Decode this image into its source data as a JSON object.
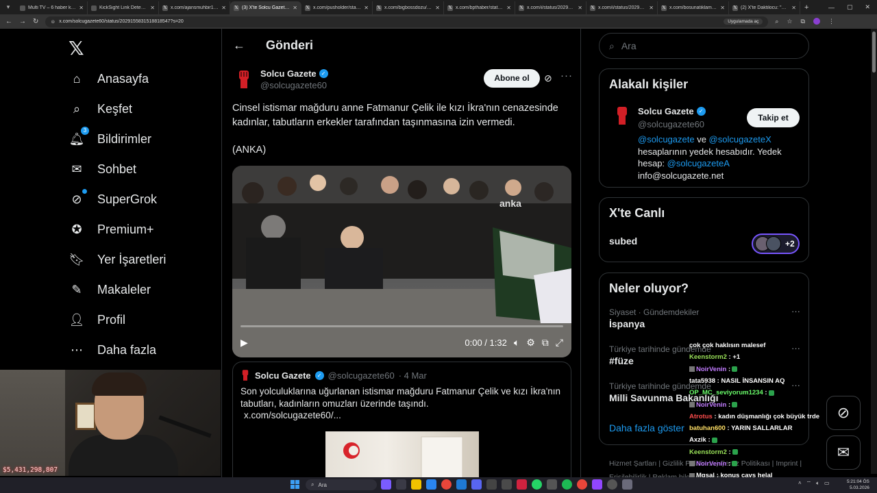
{
  "browser": {
    "tabs": [
      {
        "title": "Multi TV – 6 haber kanalını",
        "icon": "tv-icon",
        "active": false
      },
      {
        "title": "KickSight Link Detector",
        "icon": "kick-icon",
        "active": false
      },
      {
        "title": "x.com/ajansmuhbir1923/s",
        "icon": "x-icon",
        "active": false
      },
      {
        "title": "(3) X'te Solcu Gazete: \"Cin",
        "icon": "x-icon",
        "active": true
      },
      {
        "title": "x.com/pusholder/status/2",
        "icon": "x-icon",
        "active": false
      },
      {
        "title": "x.com/bigbossdozu/statu",
        "icon": "x-icon",
        "active": false
      },
      {
        "title": "x.com/bpthaber/status/2",
        "icon": "x-icon",
        "active": false
      },
      {
        "title": "x.com/i/status/20292566",
        "icon": "x-icon",
        "active": false
      },
      {
        "title": "x.com/i/status/20294861",
        "icon": "x-icon",
        "active": false
      },
      {
        "title": "x.com/bosunatiklama/stat",
        "icon": "x-icon",
        "active": false
      },
      {
        "title": "(2) X'te Daktilocu: \"Ülkem",
        "icon": "x-icon",
        "active": false
      }
    ],
    "url": "x.com/solcugazete60/status/2029155831518818547?s=20",
    "url_pill": "Uygulamada aç"
  },
  "sidebar": {
    "items": [
      {
        "label": "Anasayfa",
        "icon": "home-icon"
      },
      {
        "label": "Keşfet",
        "icon": "search-icon"
      },
      {
        "label": "Bildirimler",
        "icon": "bell-icon",
        "badge": "3"
      },
      {
        "label": "Sohbet",
        "icon": "mail-icon"
      },
      {
        "label": "SuperGrok",
        "icon": "grok-icon"
      },
      {
        "label": "Premium+",
        "icon": "verified-icon"
      },
      {
        "label": "Yer İşaretleri",
        "icon": "bookmark-icon"
      },
      {
        "label": "Makaleler",
        "icon": "article-icon"
      },
      {
        "label": "Profil",
        "icon": "profile-icon"
      },
      {
        "label": "Daha fazla",
        "icon": "more-circle-icon"
      }
    ]
  },
  "post": {
    "header_title": "Gönderi",
    "author_name": "Solcu Gazete",
    "author_handle": "@solcugazete60",
    "subscribe_label": "Abone ol",
    "text": "Cinsel istismar mağduru anne Fatmanur Çelik ile kızı İkra'nın cenazesinde kadınlar, tabutların erkekler tarafından taşınmasına izin vermedi.",
    "source": "(ANKA)",
    "video": {
      "time": "0:00 / 1:32",
      "watermark": "anka"
    },
    "quote": {
      "author_name": "Solcu Gazete",
      "author_handle": "@solcugazete60",
      "date": "· 4 Mar",
      "text": "Son yolculuklarına uğurlanan istismar mağduru Fatmanur Çelik ve kızı İkra'nın tabutları, kadınların omuzları üzerinde taşındı.",
      "link": "x.com/solcugazete60/..."
    }
  },
  "right": {
    "search_placeholder": "Ara",
    "related": {
      "title": "Alakalı kişiler",
      "name": "Solcu Gazete",
      "handle": "@solcugazete60",
      "follow_label": "Takip et",
      "bio_m1": "@solcugazete",
      "bio_and": " ve ",
      "bio_m2": "@solcugazeteX",
      "bio_mid": " hesaplarının yedek hesabıdır. Yedek hesap: ",
      "bio_m3": "@solcugazeteA",
      "bio_email": "info@solcugazete.net"
    },
    "live": {
      "title": "X'te Canlı",
      "name": "subed",
      "count": "+2"
    },
    "trends": {
      "title": "Neler oluyor?",
      "items": [
        {
          "category": "Siyaset · Gündemdekiler",
          "name": "İspanya"
        },
        {
          "category": "Türkiye tarihinde gündemde",
          "name": "#füze"
        },
        {
          "category": "Türkiye tarihinde gündemde",
          "name": "Milli Savunma Bakanlığı"
        }
      ],
      "show_more": "Daha fazla göster"
    },
    "footer": "Hizmet Şartları | Gizlilik Politikası | Çerez Politikası | Imprint | Erişilebilirlik | Reklam bilgisi | Daha fazla ..."
  },
  "overlay": {
    "money": "$5,431,298,807",
    "chat": [
      {
        "user": "",
        "msg": "çok çok haklısın malesef",
        "user_color": "#ffffff"
      },
      {
        "user": "Keenstorm2",
        "msg": " : +1",
        "user_color": "#9be35a"
      },
      {
        "user": "NoirVenin",
        "msg": " :",
        "user_color": "#c27cff"
      },
      {
        "user": "tata5938",
        "msg": " : NASIL İNSANSIN AQ",
        "user_color": "#ffffff"
      },
      {
        "user": "OP_MC_seviyorum1234",
        "msg": " :",
        "user_color": "#6bff6b"
      },
      {
        "user": "NoirVenin",
        "msg": " :",
        "user_color": "#c27cff"
      },
      {
        "user": "Atrotus",
        "msg": " : kadın düşmanlığı çok büyük trde",
        "user_color": "#ff4d4d"
      },
      {
        "user": "batuhan600",
        "msg": " : YARIN SALLARLAR",
        "user_color": "#ffe066"
      },
      {
        "user": "Axzik",
        "msg": " :",
        "user_color": "#ffffff"
      },
      {
        "user": "Keenstorm2",
        "msg": " :",
        "user_color": "#9be35a"
      },
      {
        "user": "NoirVenin",
        "msg": " :",
        "user_color": "#c27cff"
      },
      {
        "user": "Mgsal",
        "msg": " : konuş cavs helal",
        "user_color": "#ffffff"
      },
      {
        "user": "Roselia0",
        "msg": " :",
        "user_color": "#ff9ad5"
      }
    ]
  },
  "taskbar": {
    "search_placeholder": "Ara",
    "time": "5:21:04 ÖS",
    "date": "5.03.2026"
  }
}
